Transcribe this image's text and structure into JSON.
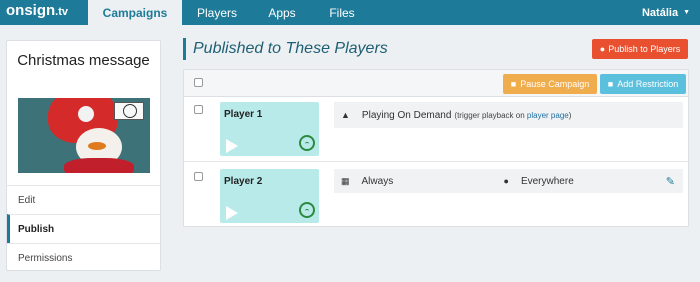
{
  "nav": {
    "logo_main": "onsign",
    "logo_tv": ".tv",
    "tabs": [
      "Campaigns",
      "Players",
      "Apps",
      "Files"
    ],
    "active_tab": "Campaigns",
    "user": "Natália"
  },
  "sidebar": {
    "campaign_title": "Christmas message",
    "menu": [
      "Edit",
      "Publish",
      "Permissions"
    ],
    "active_item": "Publish"
  },
  "main": {
    "title": "Published to These Players",
    "publish_button": "Publish to Players",
    "pause_button": "Pause Campaign",
    "add_restriction_button": "Add Restriction"
  },
  "players": [
    {
      "name": "Player 1",
      "detail_text": "Playing On Demand",
      "detail_note_prefix": "(trigger playback on",
      "detail_note_link": "player page",
      "detail_note_suffix": ")"
    },
    {
      "name": "Player 2",
      "schedule": "Always",
      "location": "Everywhere"
    }
  ],
  "colors": {
    "nav": "#1e7a99",
    "publish": "#e8502f",
    "pause": "#f0ad4e",
    "restriction": "#5bc0de",
    "player_card": "#b9eaea",
    "status_green": "#2b8a3e"
  },
  "icons": [
    "bell-icon",
    "calendar-icon",
    "map-marker-icon",
    "pencil-icon",
    "wifi-icon",
    "play-icon",
    "globe-icon",
    "pause-icon",
    "plus-icon"
  ]
}
